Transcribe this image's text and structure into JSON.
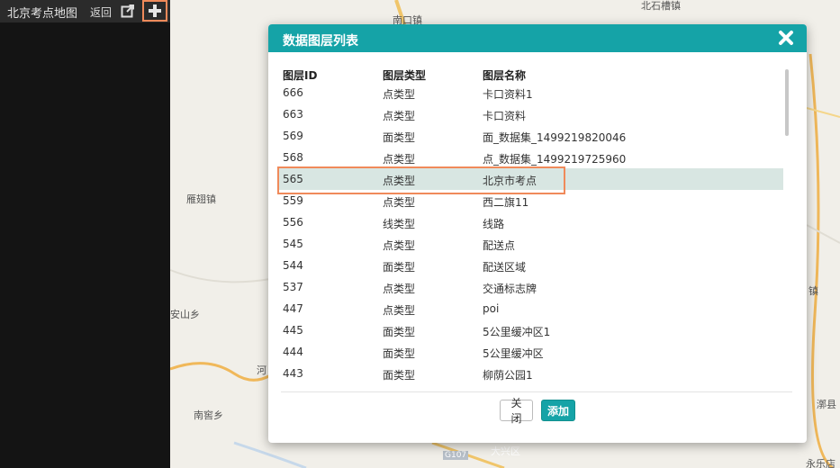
{
  "sidebar": {
    "title": "北京考点地图",
    "back_label": "返回",
    "icons": {
      "export": "export-icon",
      "add": "plus-icon"
    }
  },
  "map": {
    "labels": [
      "北石槽镇",
      "南口镇",
      "雁翅镇",
      "安山乡",
      "南窖乡",
      "漷县",
      "永乐店",
      "镇",
      "G107",
      "大兴区",
      "河"
    ]
  },
  "modal": {
    "title": "数据图层列表",
    "columns": [
      "图层ID",
      "图层类型",
      "图层名称"
    ],
    "rows": [
      [
        "666",
        "点类型",
        "卡口资料1"
      ],
      [
        "663",
        "点类型",
        "卡口资料"
      ],
      [
        "569",
        "面类型",
        "面_数据集_1499219820046"
      ],
      [
        "568",
        "点类型",
        "点_数据集_1499219725960"
      ],
      [
        "565",
        "点类型",
        "北京市考点"
      ],
      [
        "559",
        "点类型",
        "西二旗11"
      ],
      [
        "556",
        "线类型",
        "线路"
      ],
      [
        "545",
        "点类型",
        "配送点"
      ],
      [
        "544",
        "面类型",
        "配送区域"
      ],
      [
        "537",
        "点类型",
        "交通标志牌"
      ],
      [
        "447",
        "点类型",
        "poi"
      ],
      [
        "445",
        "面类型",
        "5公里缓冲区1"
      ],
      [
        "444",
        "面类型",
        "5公里缓冲区"
      ],
      [
        "443",
        "面类型",
        "柳荫公园1"
      ]
    ],
    "selected_row_id": "565",
    "close_label": "关闭",
    "add_label": "添加"
  },
  "colors": {
    "accent": "#15a3a7",
    "highlight_border": "#f08a5a",
    "selected_row": "#d8e6e2",
    "sidebar_bg": "#141414"
  }
}
